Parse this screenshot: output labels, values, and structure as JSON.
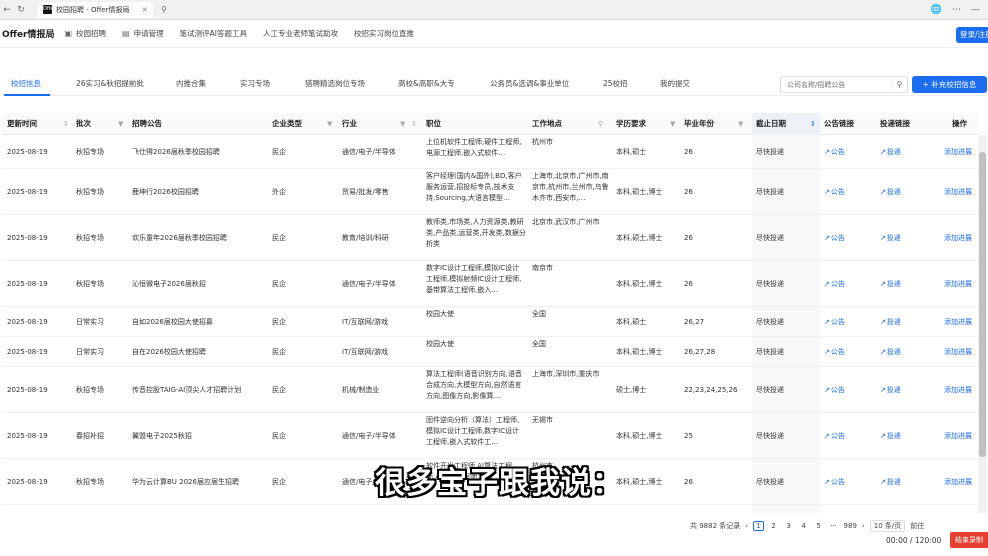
{
  "browser": {
    "tab_title": "校园招聘 - Offer情报局",
    "favicon_text": "Offer"
  },
  "header": {
    "logo": "Offer情报局",
    "nav": [
      {
        "label": "校园招聘",
        "icon": "briefcase-icon"
      },
      {
        "label": "申请管理",
        "icon": "clipboard-icon"
      },
      {
        "label": "笔试测评AI答题工具",
        "icon": ""
      },
      {
        "label": "人工专业老师笔试助攻",
        "icon": ""
      },
      {
        "label": "校招实习岗位直推",
        "icon": ""
      }
    ],
    "login_label": "登录/注册"
  },
  "categories": {
    "tabs": [
      "校招信息",
      "26实习&秋招提前批",
      "内推合集",
      "实习专场",
      "猎聘精选岗位专场",
      "高校&高职&大专",
      "公务员&选调&事业单位",
      "25校招",
      "我的提交"
    ],
    "active_index": 0,
    "search_placeholder": "公司名称/招聘公告",
    "add_label": "+ 补充校招信息"
  },
  "table": {
    "headers": [
      "更新时间",
      "批次",
      "招聘公告",
      "企业类型",
      "行业",
      "职位",
      "工作地点",
      "学历要求",
      "毕业年份",
      "截止日期",
      "公告链接",
      "投递链接",
      "操作"
    ],
    "link_notice": "公告",
    "link_apply": "投递",
    "action_label": "添加进展",
    "rows": [
      {
        "date": "2025-08-19",
        "batch": "秋招专场",
        "notice": "飞仕得2026届秋季校园招聘",
        "type": "民企",
        "industry": "通信/电子/半导体",
        "positions": "上位机软件工程师,硬件工程师,电源工程师,嵌入式软件…",
        "location": "杭州市",
        "edu": "本科,硕士",
        "year": "26",
        "deadline": "尽快投递"
      },
      {
        "date": "2025-08-19",
        "batch": "秋招专场",
        "notice": "鹿坤行2026校园招聘",
        "type": "外企",
        "industry": "贸易/批发/零售",
        "positions": "客户经理(国内&国外),BD,客户服务运营,招投标专员,技术支持,Sourcing,大语言模型…",
        "location": "上海市,北京市,广州市,南京市,杭州市,兰州市,乌鲁木齐市,西安市,…",
        "edu": "本科,硕士,博士",
        "year": "26",
        "deadline": "尽快投递"
      },
      {
        "date": "2025-08-19",
        "batch": "秋招专场",
        "notice": "欢乐童年2026届秋季校园招聘",
        "type": "民企",
        "industry": "教育/培训/科研",
        "positions": "教师类,市场类,人力资源类,教研类,产品类,运营类,开发类,数据分析类",
        "location": "北京市,武汉市,广州市",
        "edu": "本科,硕士,博士",
        "year": "26",
        "deadline": "尽快投递"
      },
      {
        "date": "2025-08-19",
        "batch": "秋招专场",
        "notice": "沁恒微电子2026届秋招",
        "type": "民企",
        "industry": "通信/电子/半导体",
        "positions": "数字IC设计工程师,模拟IC设计工程师,模拟射频IC设计工程师,基带算法工程师,嵌入…",
        "location": "南京市",
        "edu": "本科,硕士,博士",
        "year": "26",
        "deadline": "尽快投递"
      },
      {
        "date": "2025-08-19",
        "batch": "日常实习",
        "notice": "自如2026届校园大使招募",
        "type": "民企",
        "industry": "IT/互联网/游戏",
        "positions": "校园大使",
        "location": "全国",
        "edu": "本科,硕士",
        "year": "26,27",
        "deadline": "尽快投递"
      },
      {
        "date": "2025-08-19",
        "batch": "日常实习",
        "notice": "自在2026校园大使招聘",
        "type": "民企",
        "industry": "IT/互联网/游戏",
        "positions": "校园大使",
        "location": "全国",
        "edu": "本科,硕士,博士",
        "year": "26,27,28",
        "deadline": "尽快投递"
      },
      {
        "date": "2025-08-19",
        "batch": "秋招专场",
        "notice": "传音控股TAIG-AI顶尖人才招聘计划",
        "type": "民企",
        "industry": "机械/制造业",
        "positions": "算法工程师(语音识别方向,语音合成方向,大模型方向,自然语言方向,图像方向,影像算…",
        "location": "上海市,深圳市,重庆市",
        "edu": "硕士,博士",
        "year": "22,23,24,25,26",
        "deadline": "尽快投递"
      },
      {
        "date": "2025-08-19",
        "batch": "春招补招",
        "notice": "翼盟电子2025秋招",
        "type": "民企",
        "industry": "通信/电子/半导体",
        "positions": "固件逆向分析（算法）工程师,模拟IC设计工程师,数字IC设计工程师,嵌入式软件工…",
        "location": "无锡市",
        "edu": "本科,硕士,博士",
        "year": "25",
        "deadline": "尽快投递"
      },
      {
        "date": "2025-08-19",
        "batch": "秋招专场",
        "notice": "华为云计算BU 2026届应届生招聘",
        "type": "民企",
        "industry": "通信/电子/半导体",
        "positions": "软件开发工程师,AI算法工程师,AI数据工程师,AI算…",
        "location": "杭州市",
        "edu": "本科,硕士,博士",
        "year": "26",
        "deadline": "尽快投递"
      }
    ]
  },
  "pagination": {
    "total": "共 9882 条记录",
    "pages": [
      "1",
      "2",
      "3",
      "4",
      "5",
      "···",
      "989"
    ],
    "page_size": "10 条/页",
    "goto": "前往"
  },
  "overlay": {
    "subtitle": "很多宝子跟我说：",
    "timer": "00:00 / 120:00",
    "record_label": "结束录制"
  },
  "colors": {
    "accent": "#1a6cf0",
    "record": "#e64030"
  }
}
